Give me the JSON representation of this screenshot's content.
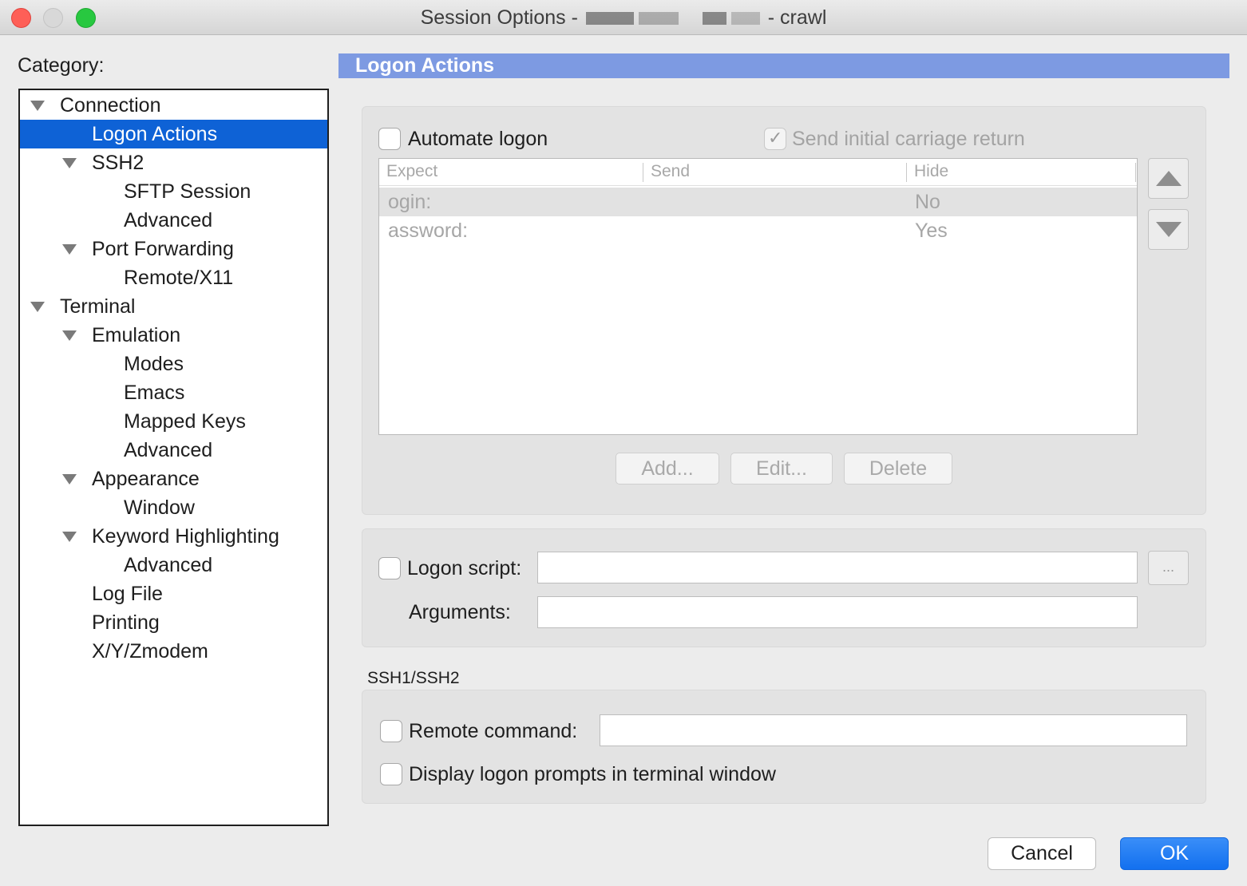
{
  "window": {
    "title_prefix": "Session Options -",
    "title_suffix": "- crawl"
  },
  "category": {
    "label": "Category:",
    "items": [
      {
        "label": "Connection",
        "level": 0,
        "expanded": true
      },
      {
        "label": "Logon Actions",
        "level": 1,
        "selected": true
      },
      {
        "label": "SSH2",
        "level": 1,
        "expanded": true
      },
      {
        "label": "SFTP Session",
        "level": 2
      },
      {
        "label": "Advanced",
        "level": 2
      },
      {
        "label": "Port Forwarding",
        "level": 1,
        "expanded": true
      },
      {
        "label": "Remote/X11",
        "level": 2
      },
      {
        "label": "Terminal",
        "level": 0,
        "expanded": true
      },
      {
        "label": "Emulation",
        "level": 1,
        "expanded": true
      },
      {
        "label": "Modes",
        "level": 2
      },
      {
        "label": "Emacs",
        "level": 2
      },
      {
        "label": "Mapped Keys",
        "level": 2
      },
      {
        "label": "Advanced",
        "level": 2
      },
      {
        "label": "Appearance",
        "level": 1,
        "expanded": true
      },
      {
        "label": "Window",
        "level": 2
      },
      {
        "label": "Keyword Highlighting",
        "level": 1,
        "expanded": true
      },
      {
        "label": "Advanced",
        "level": 2
      },
      {
        "label": "Log File",
        "level": 1
      },
      {
        "label": "Printing",
        "level": 1
      },
      {
        "label": "X/Y/Zmodem",
        "level": 1
      }
    ]
  },
  "section": {
    "title": "Logon Actions"
  },
  "logon": {
    "automate_label": "Automate logon",
    "automate_checked": false,
    "send_cr_label": "Send initial carriage return",
    "send_cr_checked": true,
    "columns": [
      "Expect",
      "Send",
      "Hide"
    ],
    "rows": [
      {
        "expect": "ogin:",
        "send": "",
        "hide": "No"
      },
      {
        "expect": "assword:",
        "send": "",
        "hide": "Yes"
      }
    ],
    "add_label": "Add...",
    "edit_label": "Edit...",
    "delete_label": "Delete",
    "move_up_icon": "triangle-up-icon",
    "move_down_icon": "triangle-down-icon"
  },
  "script": {
    "logon_script_label": "Logon script:",
    "logon_script_value": "",
    "browse_label": "...",
    "arguments_label": "Arguments:",
    "arguments_value": ""
  },
  "ssh": {
    "heading": "SSH1/SSH2",
    "remote_command_label": "Remote command:",
    "remote_command_value": "",
    "display_prompts_label": "Display logon prompts in terminal window"
  },
  "buttons": {
    "cancel": "Cancel",
    "ok": "OK"
  },
  "colors": {
    "selection": "#0e62d6",
    "section_header": "#7d9ae2",
    "ok_button": "#1370ef"
  }
}
